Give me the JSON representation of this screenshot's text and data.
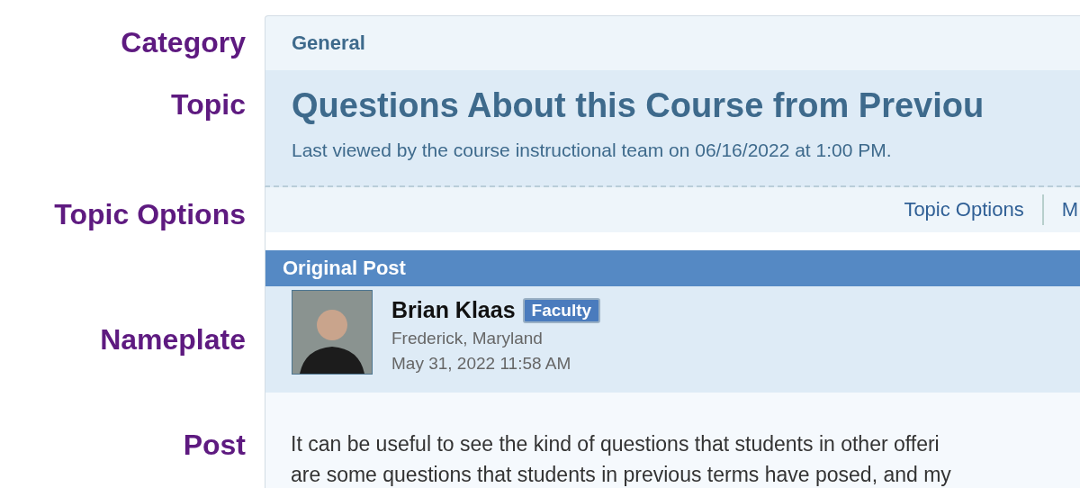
{
  "annotations": [
    "Category",
    "Topic",
    "Topic Options",
    "Nameplate",
    "Post"
  ],
  "forum": {
    "category": "General",
    "topic_title": "Questions About this Course from Previou",
    "last_viewed": "Last viewed by the course instructional team on 06/16/2022 at 1:00 PM.",
    "options": [
      "Topic Options",
      "M"
    ],
    "post_header": "Original Post",
    "author": {
      "name": "Brian Klaas",
      "badge": "Faculty",
      "location": "Frederick, Maryland",
      "date": "May 31, 2022 11:58 AM"
    },
    "body": [
      "It can be useful to see the kind of questions that students in other offeri",
      "are some questions that students in previous terms have posed, and my"
    ]
  }
}
